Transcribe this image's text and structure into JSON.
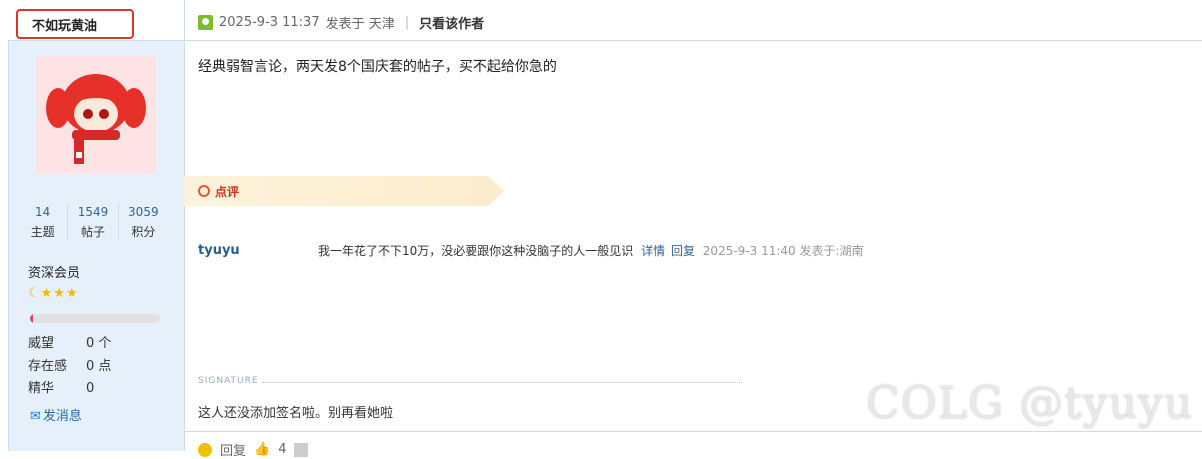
{
  "author": {
    "name": "不如玩黄油"
  },
  "stats": [
    {
      "value": "14",
      "label": "主题"
    },
    {
      "value": "1549",
      "label": "帖子"
    },
    {
      "value": "3059",
      "label": "积分"
    }
  ],
  "rank": {
    "title": "资深会员",
    "stars": [
      "moon-icon",
      "star-icon",
      "star-icon",
      "star-icon"
    ],
    "progress": 0.02
  },
  "profile_fields": [
    {
      "key": "威望",
      "value": "0 个"
    },
    {
      "key": "存在感",
      "value": "0 点"
    },
    {
      "key": "精华",
      "value": "0"
    }
  ],
  "pm_label": "发消息",
  "post_meta": {
    "datetime": "2025-9-3 11:37",
    "posted_in": "发表于 天津",
    "only_author": "只看该作者"
  },
  "post_body": "经典弱智言论，两天发8个国庆套的帖子，买不起给你急的",
  "comment_section": {
    "label": "点评"
  },
  "comment": {
    "user": "tyuyu",
    "text": "我一年花了不下10万，没必要跟你这种没脑子的人一般见识",
    "detail": "详情",
    "reply": "回复",
    "date": "2025-9-3 11:40 发表于:湖南"
  },
  "signature": {
    "label": "SIGNATURE",
    "text": "这人还没添加签名啦。别再看她啦"
  },
  "footer": {
    "reply_label": "回复",
    "like_count": "4"
  },
  "watermark": "COLG @tyuyu",
  "colors": {
    "accent": "#336699",
    "highlight_box": "#d9352b",
    "sidebar": "#e6f0fa"
  }
}
